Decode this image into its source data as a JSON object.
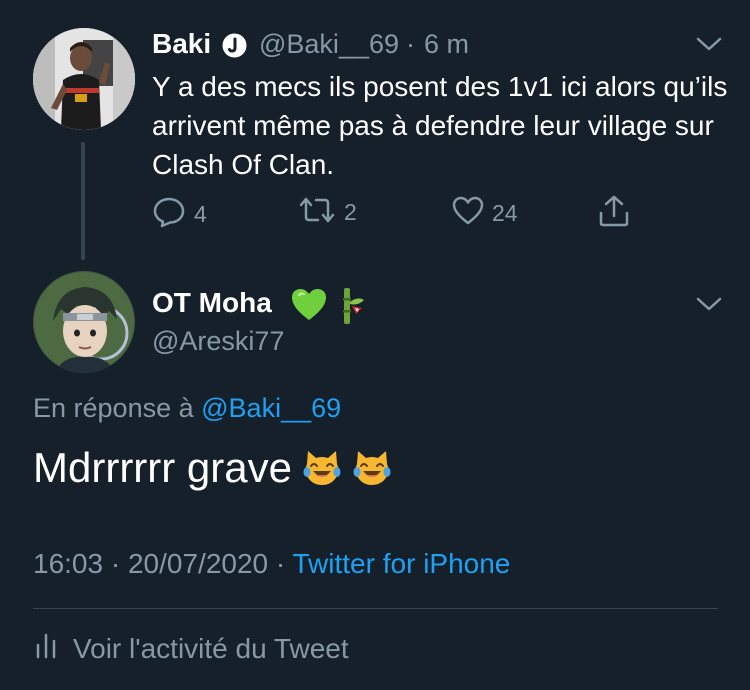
{
  "tweet1": {
    "name": "Baki",
    "handle": "@Baki__69",
    "separator": "·",
    "time": "6 m",
    "text": "Y a des mecs ils posent des 1v1 ici alors qu’ils arrivent même pas à defendre leur village sur Clash Of Clan.",
    "reply_count": "4",
    "retweet_count": "2",
    "like_count": "24"
  },
  "tweet2": {
    "name": "OT Moha",
    "handle": "@Areski77",
    "reply_prefix": "En réponse à",
    "reply_handle": "@Baki__69",
    "text": "Mdrrrrrr grave",
    "time": "16:03",
    "meta_sep1": "·",
    "date": "20/07/2020",
    "meta_sep2": "·",
    "source": "Twitter for iPhone",
    "activity_label": "Voir l'activité du Tweet"
  },
  "icons": {
    "verified": "verified-badge-icon",
    "caret": "chevron-down-icon",
    "reply": "reply-icon",
    "retweet": "retweet-icon",
    "like": "heart-icon",
    "share": "share-icon",
    "activity": "bar-chart-icon",
    "green_heart": "green-heart-emoji",
    "bamboo": "bamboo-emoji",
    "laughing_cat": "cat-tears-of-joy-emoji"
  },
  "colors": {
    "background": "#15202b",
    "text": "#ffffff",
    "muted": "#8899a6",
    "link": "#1da1f2",
    "divider": "#38444d"
  }
}
